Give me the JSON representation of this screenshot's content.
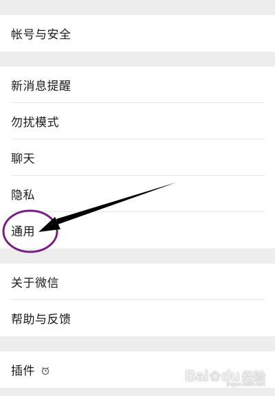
{
  "settings": {
    "groups": [
      {
        "items": [
          {
            "label": "帐号与安全"
          }
        ]
      },
      {
        "items": [
          {
            "label": "新消息提醒"
          },
          {
            "label": "勿扰模式"
          },
          {
            "label": "聊天"
          },
          {
            "label": "隐私"
          },
          {
            "label": "通用"
          }
        ]
      },
      {
        "items": [
          {
            "label": "关于微信"
          },
          {
            "label": "帮助与反馈"
          }
        ]
      },
      {
        "items": [
          {
            "label": "插件",
            "icon": "plugin-icon"
          }
        ]
      }
    ]
  },
  "annotation": {
    "circle_color": "#7b1a82",
    "arrow_color": "#000000"
  },
  "watermark": {
    "brand": "Bai",
    "brand2": "du",
    "cn": "经验",
    "sub": "jingyan.baidu.com"
  }
}
